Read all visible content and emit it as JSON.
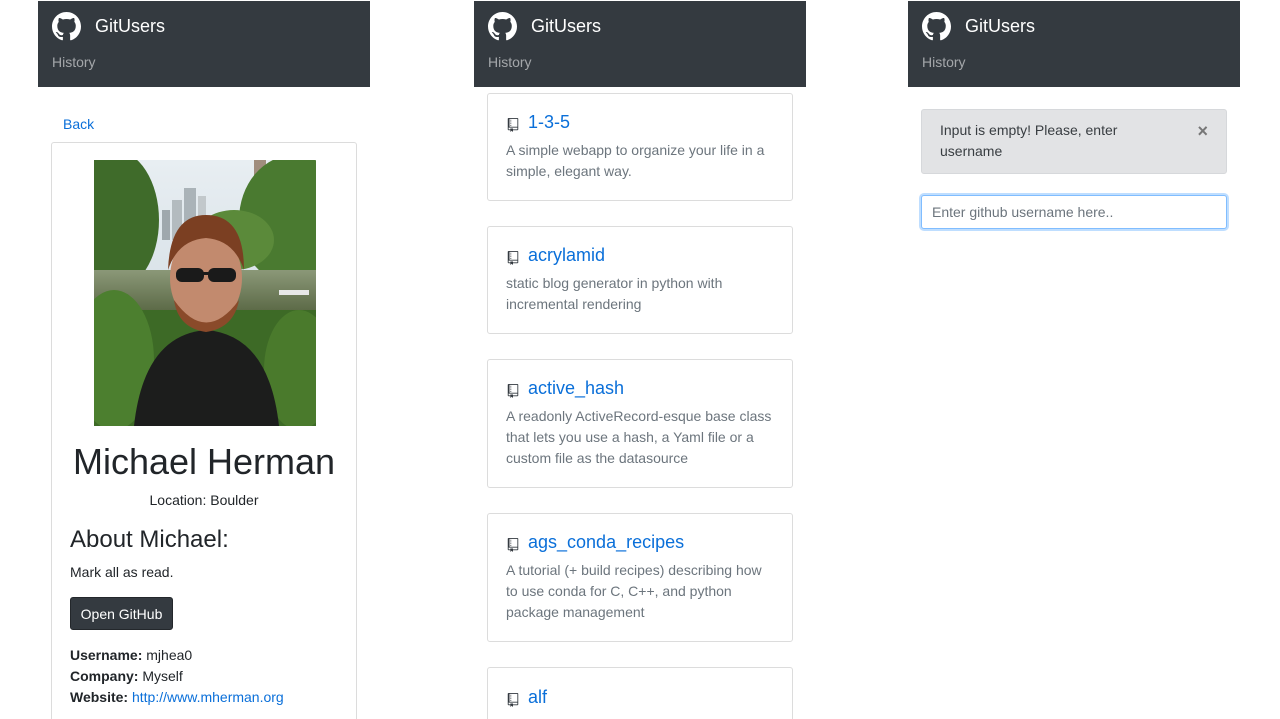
{
  "navbar": {
    "brand": "GitUsers",
    "history_link": "History",
    "logo_icon": "github-octocat-icon"
  },
  "user_view": {
    "back_link": "Back",
    "name": "Michael Herman",
    "location": "Location: Boulder",
    "about_heading": "About Michael:",
    "bio": "Mark all as read.",
    "open_button": "Open GitHub",
    "username_label": "Username:",
    "username_value": "mjhea0",
    "company_label": "Company:",
    "company_value": "Myself",
    "website_label": "Website:",
    "website_value": "http://www.mherman.org"
  },
  "repos_view": {
    "repos": [
      {
        "name": "1-3-5",
        "description": "A simple webapp to organize your life in a simple, elegant way."
      },
      {
        "name": "acrylamid",
        "description": "static blog generator in python with incremental rendering"
      },
      {
        "name": "active_hash",
        "description": "A readonly ActiveRecord-esque base class that lets you use a hash, a Yaml file or a custom file as the datasource"
      },
      {
        "name": "ags_conda_recipes",
        "description": "A tutorial (+ build recipes) describing how to use conda for C, C++, and python package management"
      },
      {
        "name": "alf",
        "description": ""
      }
    ]
  },
  "search_view": {
    "alert_message": "Input is empty! Please, enter username",
    "alert_close": "×",
    "input_placeholder": "Enter github username here..",
    "input_value": ""
  },
  "colors": {
    "navbar": "#343a40",
    "link": "#0a6fd9",
    "muted": "#6c757d",
    "alert_bg": "#e2e3e5"
  }
}
